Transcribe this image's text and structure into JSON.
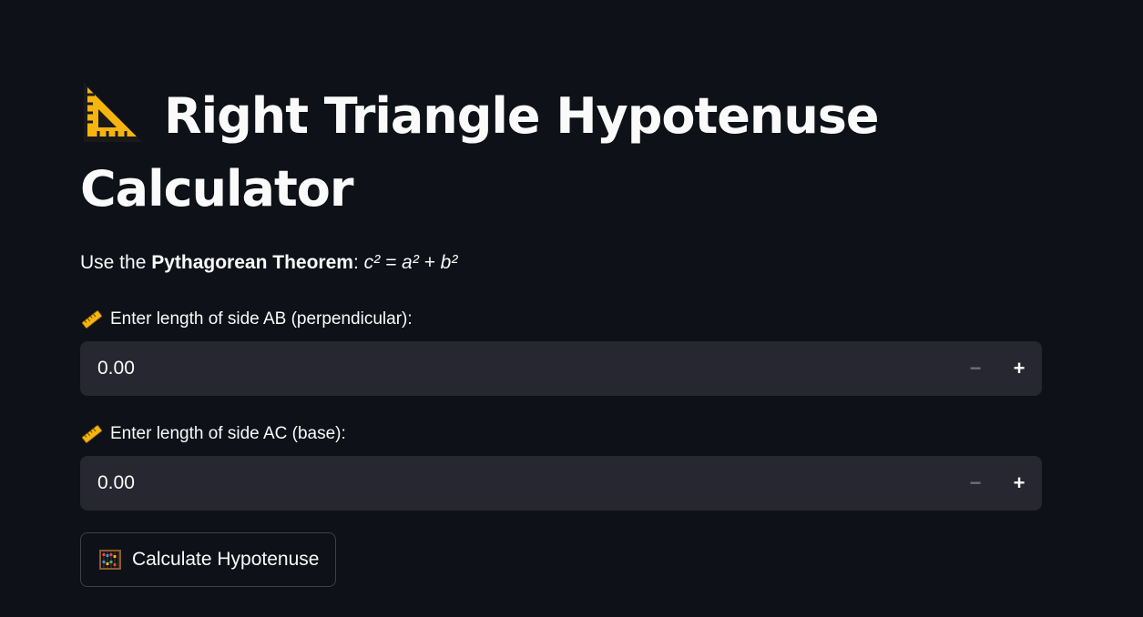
{
  "header": {
    "title": "Right Triangle Hypotenuse Calculator",
    "title_icon": "triangular-ruler-icon"
  },
  "intro": {
    "prefix": "Use the ",
    "bold": "Pythagorean Theorem",
    "colon": ": ",
    "formula": "c² = a² + b²"
  },
  "fields": [
    {
      "label": "Enter length of side AB (perpendicular):",
      "icon": "straight-ruler-icon",
      "value": "0.00",
      "minus": "−",
      "plus": "+"
    },
    {
      "label": "Enter length of side AC (base):",
      "icon": "straight-ruler-icon",
      "value": "0.00",
      "minus": "−",
      "plus": "+"
    }
  ],
  "action": {
    "label": "Calculate Hypotenuse",
    "icon": "abacus-icon"
  },
  "colors": {
    "background": "#0e1117",
    "input_bg": "#262730",
    "text": "#fafafa",
    "disabled": "#6c6e76"
  }
}
